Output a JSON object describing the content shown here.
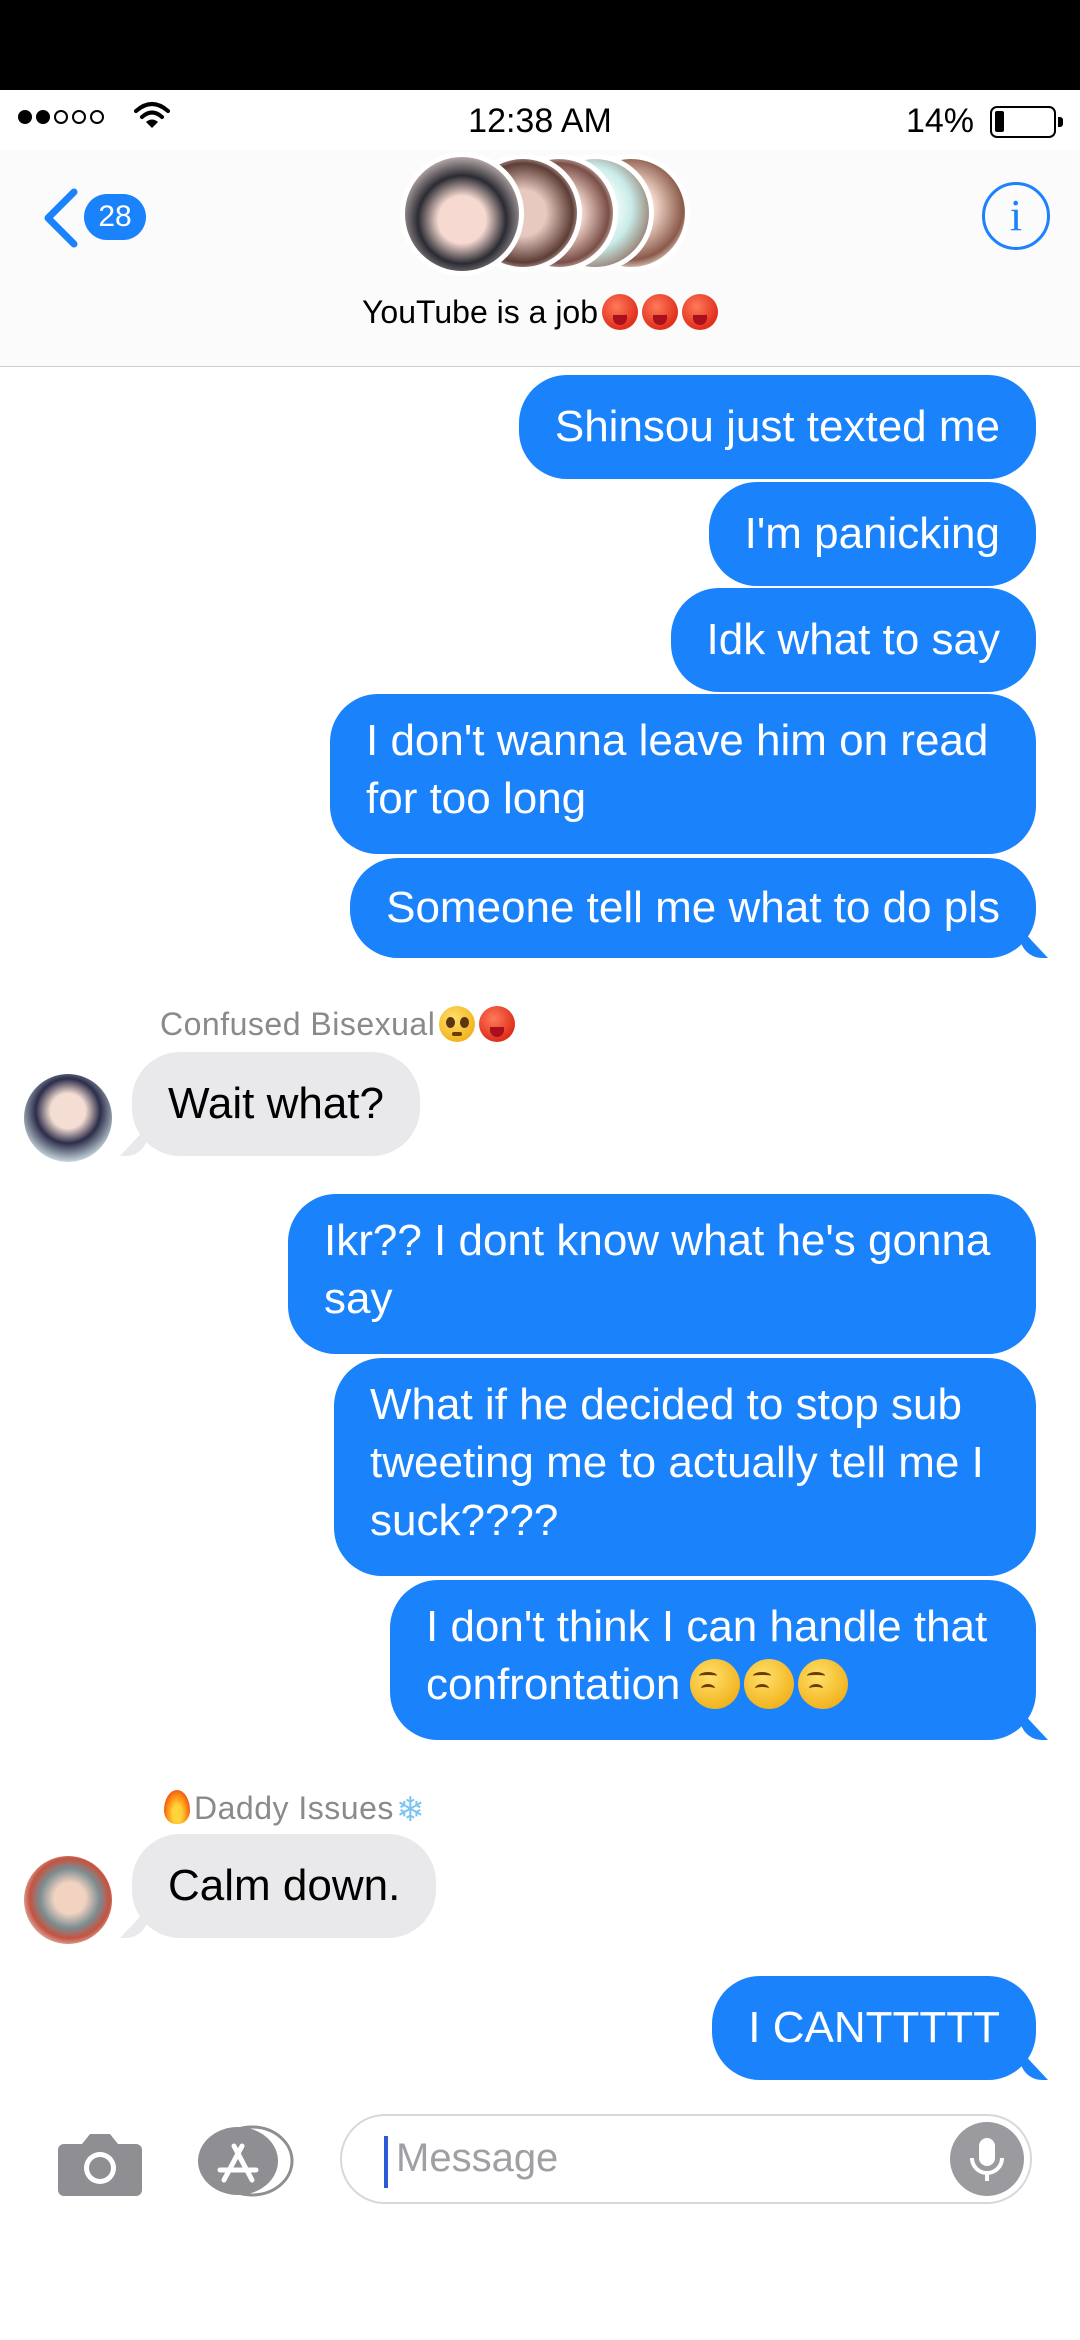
{
  "status_bar": {
    "time": "12:38 AM",
    "battery": "14%"
  },
  "header": {
    "back_count": "28",
    "chat_name": "YouTube is a job",
    "name_emojis": [
      "hot-face-emoji",
      "hot-face-emoji",
      "hot-face-emoji"
    ]
  },
  "messages": [
    {
      "dir": "out",
      "text": "Shinsou just texted me"
    },
    {
      "dir": "out",
      "text": "I'm panicking"
    },
    {
      "dir": "out",
      "text": "Idk what to say"
    },
    {
      "dir": "out",
      "text_lines": [
        "I don't wanna leave him on read",
        "for too long"
      ]
    },
    {
      "dir": "out",
      "text": "Someone tell me what to do pls"
    },
    {
      "dir": "in",
      "sender": "Confused Bisexual",
      "text": "Wait what?"
    },
    {
      "dir": "out",
      "text_lines": [
        "Ikr?? I dont know what he's gonna",
        "say"
      ]
    },
    {
      "dir": "out",
      "text_lines": [
        "What if he decided to stop sub",
        "tweeting me to actually tell me I",
        "suck????"
      ]
    },
    {
      "dir": "out",
      "text_lines": [
        "I don't think I can handle that",
        "confrontation"
      ]
    },
    {
      "dir": "in",
      "sender": "Daddy Issues",
      "text": "Calm down."
    },
    {
      "dir": "out",
      "text": "I CANTTTTT"
    }
  ],
  "composer": {
    "placeholder": "Message"
  },
  "colors": {
    "blue": "#1a82fb",
    "gray_bubble": "#e9e9eb"
  },
  "icons": [
    "back-chevron-icon",
    "info-icon",
    "camera-icon",
    "app-store-icon",
    "mic-icon"
  ]
}
